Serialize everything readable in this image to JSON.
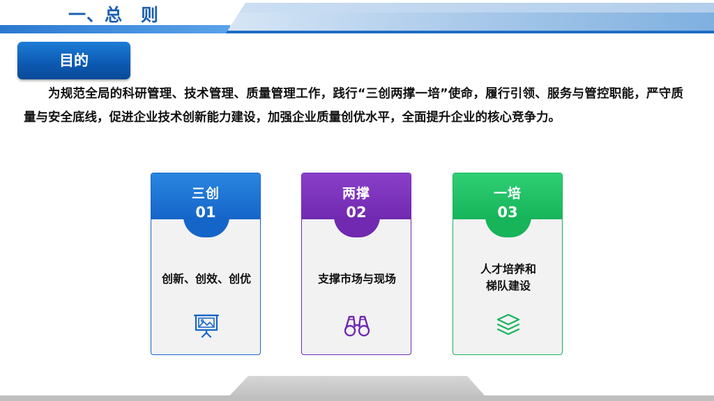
{
  "header": {
    "title": "一、总　则"
  },
  "purpose": {
    "tag": "目的",
    "text": "为规范全局的科研管理、技术管理、质量管理工作，践行“三创两撑一培”使命，履行引领、服务与管控职能，严守质量与安全底线，促进企业技术创新能力建设，加强企业质量创优水平，全面提升企业的核心竞争力。"
  },
  "cards": [
    {
      "title": "三创",
      "number": "01",
      "desc": "创新、创效、创优",
      "icon": "presentation-board-icon",
      "color": "#1565c8",
      "color_light": "#2a86e0"
    },
    {
      "title": "两撑",
      "number": "02",
      "desc": "支撑市场与现场",
      "icon": "binoculars-icon",
      "color": "#7029b0",
      "color_light": "#8a3fc9"
    },
    {
      "title": "一培",
      "number": "03",
      "desc": "人才培养和梯队建设",
      "icon": "layers-icon",
      "color": "#17b45a",
      "color_light": "#2fcf74"
    }
  ]
}
